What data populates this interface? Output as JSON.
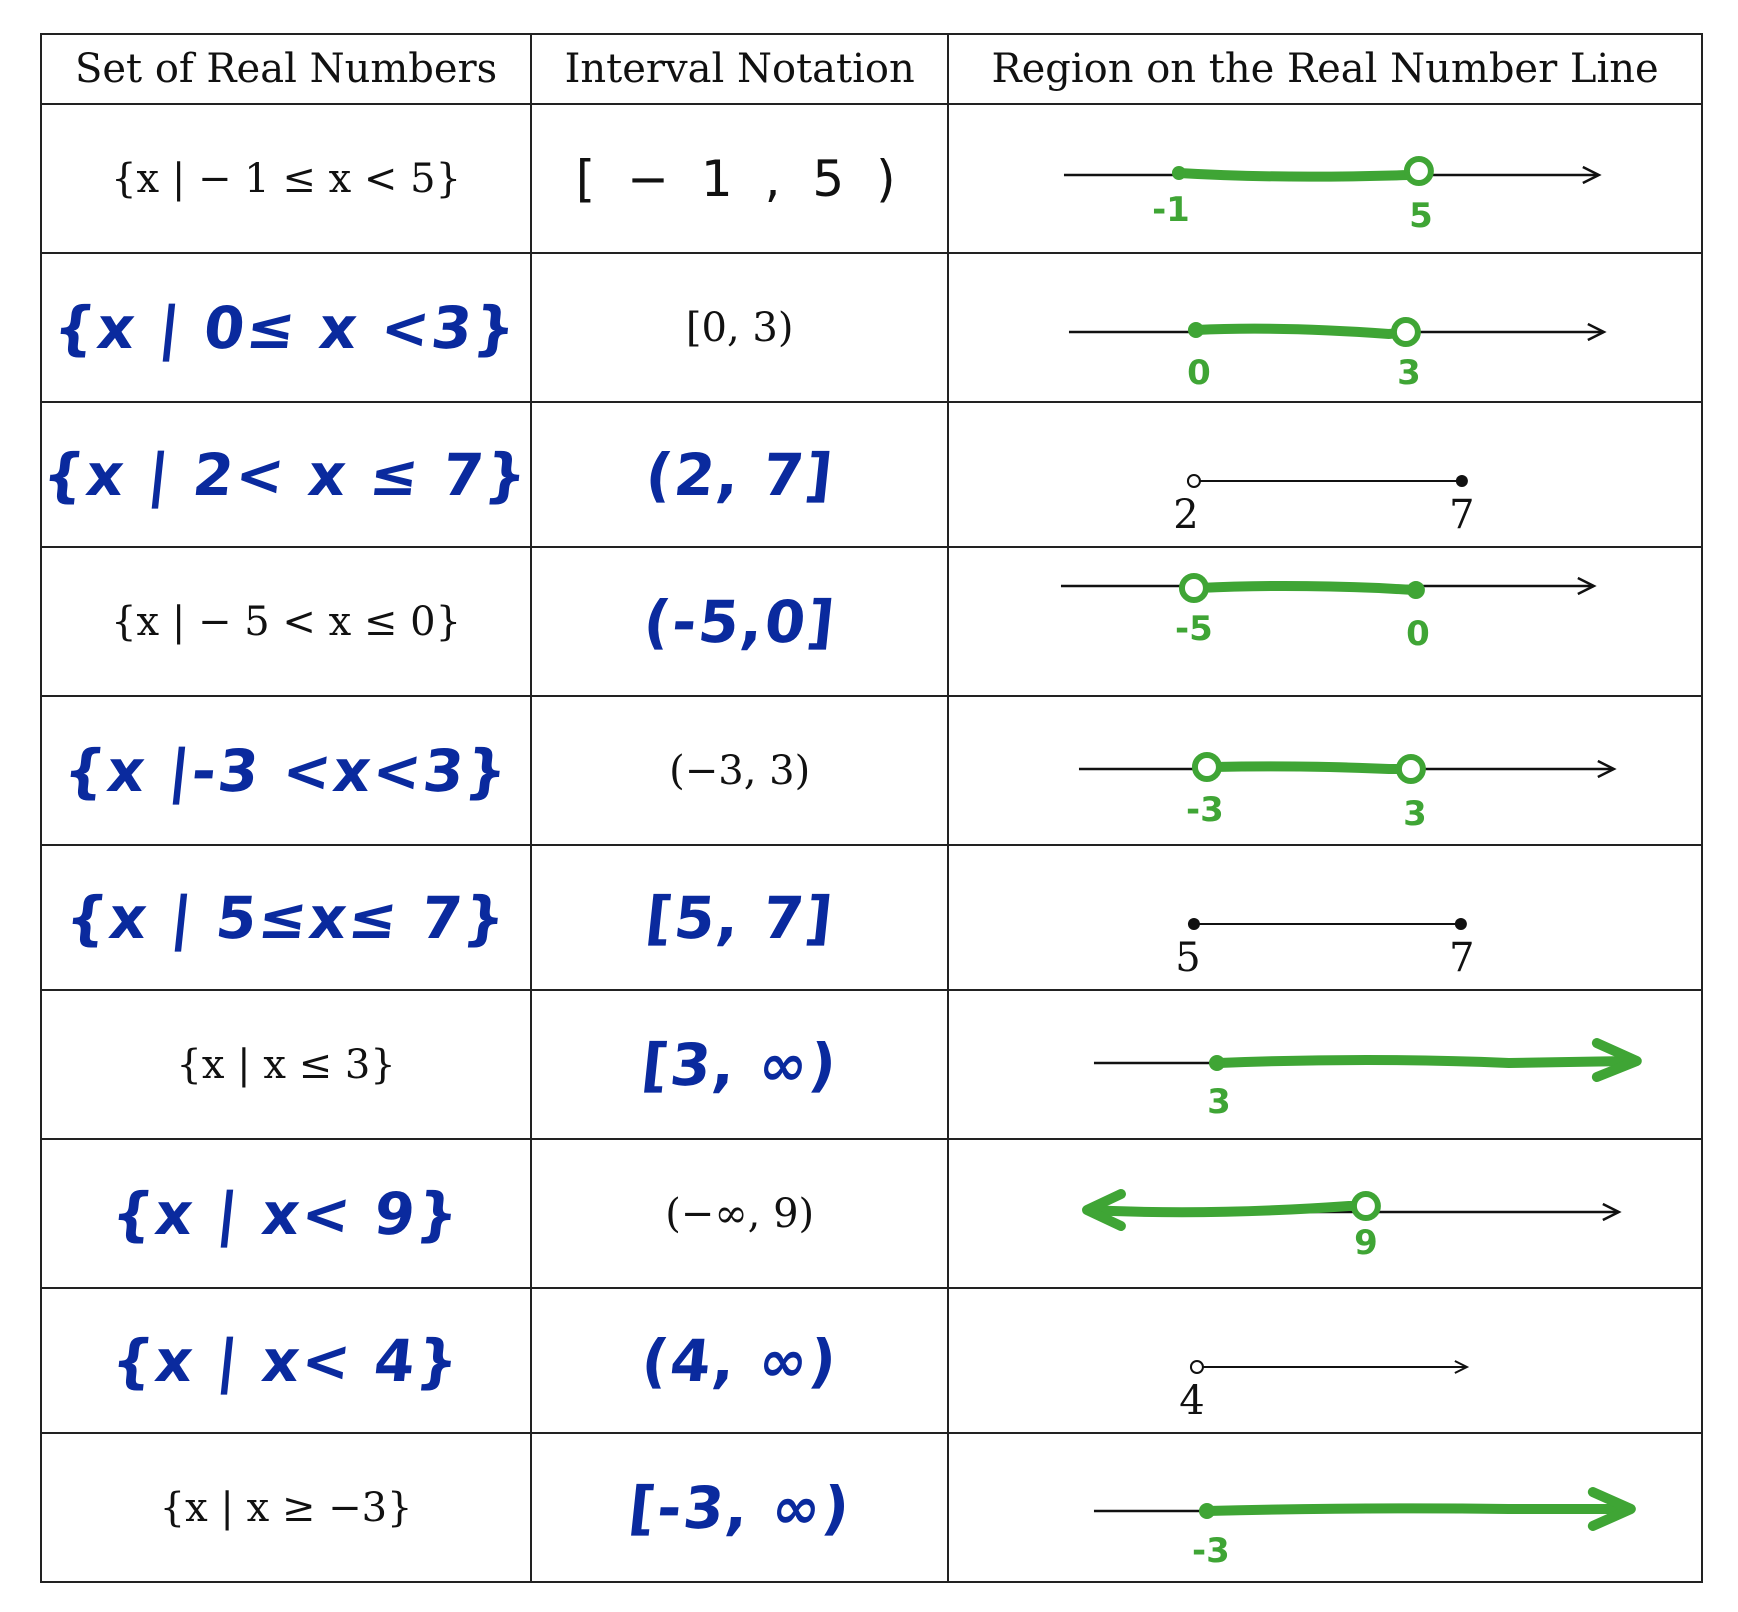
{
  "headers": [
    "Set of Real Numbers",
    "Interval Notation",
    "Region on the Real Number Line"
  ],
  "rows": [
    {
      "set": "{x | − 1 ≤ x < 5}",
      "set_style": "typed",
      "interval": "[ − 1 , 5 )",
      "interval_style": "thin",
      "line": {
        "style": "green",
        "labels": [
          "-1",
          "5"
        ]
      }
    },
    {
      "set": "{x | 0≤ x <3}",
      "set_style": "hand",
      "interval": "[0, 3)",
      "interval_style": "typed",
      "line": {
        "style": "green",
        "labels": [
          "0",
          "3"
        ]
      }
    },
    {
      "set": "{x | 2< x ≤ 7}",
      "set_style": "hand",
      "interval": "(2, 7]",
      "interval_style": "hand",
      "line": {
        "style": "black",
        "labels": [
          "2",
          "7"
        ]
      }
    },
    {
      "set": "{x | − 5 < x ≤ 0}",
      "set_style": "typed",
      "interval": "(-5,0]",
      "interval_style": "hand",
      "line": {
        "style": "green",
        "labels": [
          "-5",
          "0"
        ]
      }
    },
    {
      "set": "{x |-3 <x<3}",
      "set_style": "hand",
      "interval": "(−3, 3)",
      "interval_style": "typed",
      "line": {
        "style": "green",
        "labels": [
          "-3",
          "3"
        ]
      }
    },
    {
      "set": "{x | 5≤x≤ 7}",
      "set_style": "hand",
      "interval": "[5, 7]",
      "interval_style": "hand",
      "line": {
        "style": "black",
        "labels": [
          "5",
          "7"
        ]
      }
    },
    {
      "set": "{x | x ≤ 3}",
      "set_style": "typed",
      "interval": "[3, ∞)",
      "interval_style": "hand",
      "line": {
        "style": "green",
        "labels": [
          "3"
        ]
      }
    },
    {
      "set": "{x | x< 9}",
      "set_style": "hand",
      "interval": "(−∞, 9)",
      "interval_style": "typed",
      "line": {
        "style": "green",
        "labels": [
          "9"
        ]
      }
    },
    {
      "set": "{x | x< 4}",
      "set_style": "hand",
      "interval": "(4, ∞)",
      "interval_style": "hand",
      "line": {
        "style": "black",
        "labels": [
          "4"
        ]
      }
    },
    {
      "set": "{x | x ≥ −3}",
      "set_style": "typed",
      "interval": "[-3, ∞)",
      "interval_style": "hand",
      "line": {
        "style": "green",
        "labels": [
          "-3"
        ]
      }
    }
  ]
}
